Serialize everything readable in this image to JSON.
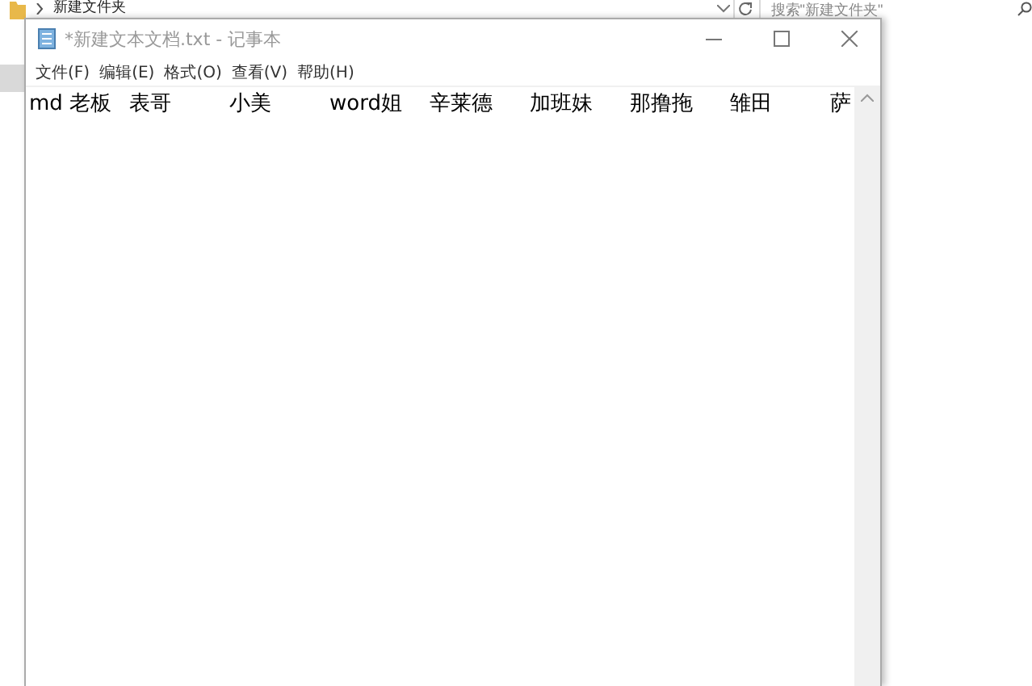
{
  "explorer": {
    "breadcrumb": "新建文件夹",
    "search": {
      "placeholder": "搜索\"新建文件夹\""
    }
  },
  "notepad": {
    "title": "*新建文本文档.txt - 记事本",
    "menu": [
      "文件(F)",
      "编辑(E)",
      "格式(O)",
      "查看(V)",
      "帮助(H)"
    ],
    "text": [
      "md 老板",
      "表哥",
      "小美",
      "word姐",
      "辛莱德",
      "加班妹",
      "那撸拖",
      "雏田",
      "萨"
    ]
  }
}
